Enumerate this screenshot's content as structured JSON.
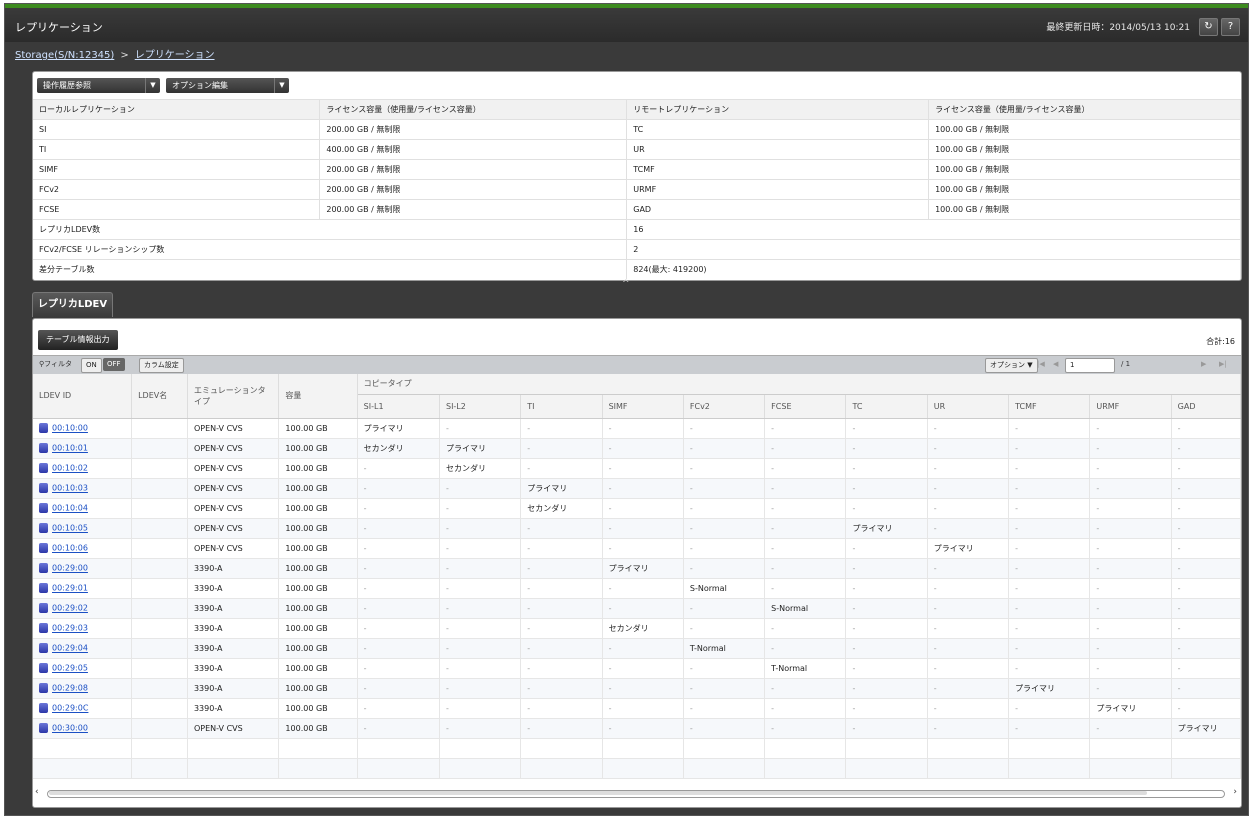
{
  "window": {
    "title": "レプリケーション",
    "last_updated_label": "最終更新日時：2014/05/13 10:21",
    "refresh_icon": "refresh-icon",
    "help_label": "?"
  },
  "breadcrumb": {
    "storage": "Storage(S/N:12345)",
    "sep": ">",
    "current": "レプリケーション"
  },
  "summary": {
    "toolbar": {
      "history_label": "操作履歴参照",
      "option_label": "オプション編集"
    },
    "headers": [
      "ローカルレプリケーション",
      "ライセンス容量（使用量/ライセンス容量）",
      "リモートレプリケーション",
      "ライセンス容量（使用量/ライセンス容量）"
    ],
    "rows": [
      [
        "SI",
        "200.00 GB / 無制限",
        "TC",
        "100.00 GB / 無制限"
      ],
      [
        "TI",
        "400.00 GB / 無制限",
        "UR",
        "100.00 GB / 無制限"
      ],
      [
        "SIMF",
        "200.00 GB / 無制限",
        "TCMF",
        "100.00 GB / 無制限"
      ],
      [
        "FCv2",
        "200.00 GB / 無制限",
        "URMF",
        "100.00 GB / 無制限"
      ],
      [
        "FCSE",
        "200.00 GB / 無制限",
        "GAD",
        "100.00 GB / 無制限"
      ]
    ],
    "extra_rows": [
      [
        "レプリカLDEV数",
        "16"
      ],
      [
        "FCv2/FCSE リレーションシップ数",
        "2"
      ],
      [
        "差分テーブル数",
        "824(最大: 419200)"
      ]
    ]
  },
  "tab": {
    "label": "レプリカLDEV"
  },
  "panel": {
    "export_label": "テーブル情報出力",
    "total_label": "合計:16",
    "filter": {
      "label": "フィルタ",
      "on": "ON",
      "off": "OFF",
      "column_settings": "カラム設定",
      "options": "オプション",
      "page": "1",
      "page_total": "/ 1"
    },
    "headers": {
      "ldev_id": "LDEV ID",
      "ldev_name": "LDEV名",
      "emulation": "エミュレーションタイプ",
      "capacity": "容量",
      "copy_type": "コピータイプ"
    },
    "copy_columns": [
      "SI-L1",
      "SI-L2",
      "TI",
      "SIMF",
      "FCv2",
      "FCSE",
      "TC",
      "UR",
      "TCMF",
      "URMF",
      "GAD"
    ],
    "rows": [
      {
        "id": "00:10:00",
        "name": "",
        "emu": "OPEN-V CVS",
        "cap": "100.00 GB",
        "types": [
          "プライマリ",
          "-",
          "-",
          "-",
          "-",
          "-",
          "-",
          "-",
          "-",
          "-",
          "-"
        ]
      },
      {
        "id": "00:10:01",
        "name": "",
        "emu": "OPEN-V CVS",
        "cap": "100.00 GB",
        "types": [
          "セカンダリ",
          "プライマリ",
          "-",
          "-",
          "-",
          "-",
          "-",
          "-",
          "-",
          "-",
          "-"
        ]
      },
      {
        "id": "00:10:02",
        "name": "",
        "emu": "OPEN-V CVS",
        "cap": "100.00 GB",
        "types": [
          "-",
          "セカンダリ",
          "-",
          "-",
          "-",
          "-",
          "-",
          "-",
          "-",
          "-",
          "-"
        ]
      },
      {
        "id": "00:10:03",
        "name": "",
        "emu": "OPEN-V CVS",
        "cap": "100.00 GB",
        "types": [
          "-",
          "-",
          "プライマリ",
          "-",
          "-",
          "-",
          "-",
          "-",
          "-",
          "-",
          "-"
        ]
      },
      {
        "id": "00:10:04",
        "name": "",
        "emu": "OPEN-V CVS",
        "cap": "100.00 GB",
        "types": [
          "-",
          "-",
          "セカンダリ",
          "-",
          "-",
          "-",
          "-",
          "-",
          "-",
          "-",
          "-"
        ]
      },
      {
        "id": "00:10:05",
        "name": "",
        "emu": "OPEN-V CVS",
        "cap": "100.00 GB",
        "types": [
          "-",
          "-",
          "-",
          "-",
          "-",
          "-",
          "プライマリ",
          "-",
          "-",
          "-",
          "-"
        ]
      },
      {
        "id": "00:10:06",
        "name": "",
        "emu": "OPEN-V CVS",
        "cap": "100.00 GB",
        "types": [
          "-",
          "-",
          "-",
          "-",
          "-",
          "-",
          "-",
          "プライマリ",
          "-",
          "-",
          "-"
        ]
      },
      {
        "id": "00:29:00",
        "name": "",
        "emu": "3390-A",
        "cap": "100.00 GB",
        "types": [
          "-",
          "-",
          "-",
          "プライマリ",
          "-",
          "-",
          "-",
          "-",
          "-",
          "-",
          "-"
        ]
      },
      {
        "id": "00:29:01",
        "name": "",
        "emu": "3390-A",
        "cap": "100.00 GB",
        "types": [
          "-",
          "-",
          "-",
          "-",
          "S-Normal",
          "-",
          "-",
          "-",
          "-",
          "-",
          "-"
        ]
      },
      {
        "id": "00:29:02",
        "name": "",
        "emu": "3390-A",
        "cap": "100.00 GB",
        "types": [
          "-",
          "-",
          "-",
          "-",
          "-",
          "S-Normal",
          "-",
          "-",
          "-",
          "-",
          "-"
        ]
      },
      {
        "id": "00:29:03",
        "name": "",
        "emu": "3390-A",
        "cap": "100.00 GB",
        "types": [
          "-",
          "-",
          "-",
          "セカンダリ",
          "-",
          "-",
          "-",
          "-",
          "-",
          "-",
          "-"
        ]
      },
      {
        "id": "00:29:04",
        "name": "",
        "emu": "3390-A",
        "cap": "100.00 GB",
        "types": [
          "-",
          "-",
          "-",
          "-",
          "T-Normal",
          "-",
          "-",
          "-",
          "-",
          "-",
          "-"
        ]
      },
      {
        "id": "00:29:05",
        "name": "",
        "emu": "3390-A",
        "cap": "100.00 GB",
        "types": [
          "-",
          "-",
          "-",
          "-",
          "-",
          "T-Normal",
          "-",
          "-",
          "-",
          "-",
          "-"
        ]
      },
      {
        "id": "00:29:08",
        "name": "",
        "emu": "3390-A",
        "cap": "100.00 GB",
        "types": [
          "-",
          "-",
          "-",
          "-",
          "-",
          "-",
          "-",
          "-",
          "プライマリ",
          "-",
          "-"
        ]
      },
      {
        "id": "00:29:0C",
        "name": "",
        "emu": "3390-A",
        "cap": "100.00 GB",
        "types": [
          "-",
          "-",
          "-",
          "-",
          "-",
          "-",
          "-",
          "-",
          "-",
          "プライマリ",
          "-"
        ]
      },
      {
        "id": "00:30:00",
        "name": "",
        "emu": "OPEN-V CVS",
        "cap": "100.00 GB",
        "types": [
          "-",
          "-",
          "-",
          "-",
          "-",
          "-",
          "-",
          "-",
          "-",
          "-",
          "プライマリ"
        ]
      }
    ]
  }
}
